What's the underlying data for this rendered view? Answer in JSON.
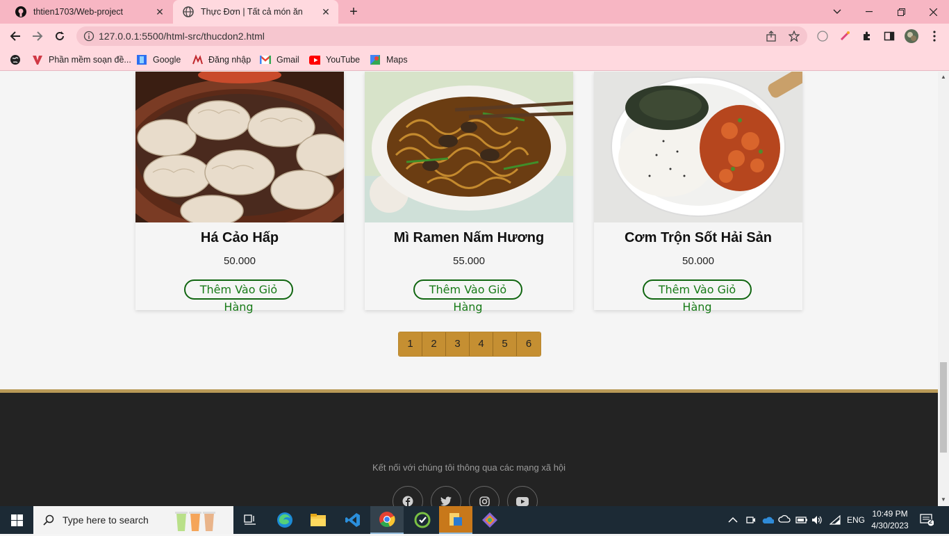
{
  "browser": {
    "tabs": [
      {
        "title": "thtien1703/Web-project",
        "active": false
      },
      {
        "title": "Thực Đơn | Tất cả món ăn",
        "active": true
      }
    ],
    "url": "127.0.0.1:5500/html-src/thucdon2.html",
    "bookmarks": [
      {
        "label": "Phần mềm soạn đề...",
        "icon": "v-logo-icon"
      },
      {
        "label": "Google",
        "icon": "google-icon"
      },
      {
        "label": "Đăng nhập",
        "icon": "login-icon"
      },
      {
        "label": "Gmail",
        "icon": "gmail-icon"
      },
      {
        "label": "YouTube",
        "icon": "youtube-icon"
      },
      {
        "label": "Maps",
        "icon": "maps-icon"
      }
    ]
  },
  "menu": {
    "items": [
      {
        "name": "Há Cảo Hấp",
        "price": "50.000",
        "button": "Thêm Vào Giỏ Hàng"
      },
      {
        "name": "Mì Ramen Nấm Hương",
        "price": "55.000",
        "button": "Thêm Vào Giỏ Hàng"
      },
      {
        "name": "Cơm Trộn Sốt Hải Sản",
        "price": "50.000",
        "button": "Thêm Vào Giỏ Hàng"
      }
    ],
    "pages": [
      "1",
      "2",
      "3",
      "4",
      "5",
      "6"
    ]
  },
  "footer": {
    "tagline": "Kết nối với chúng tôi thông qua các mạng xã hội",
    "social": [
      "facebook-icon",
      "twitter-icon",
      "instagram-icon",
      "youtube-icon"
    ]
  },
  "taskbar": {
    "search_placeholder": "Type here to search",
    "language": "ENG",
    "time": "10:49 PM",
    "date": "4/30/2023",
    "notifications": "2"
  },
  "colors": {
    "tab_bar": "#f7b6c3",
    "toolbar": "#ffd9df",
    "pager": "#c58f32",
    "footer": "#232323",
    "footer_border": "#b99a57",
    "button_green": "#177a17"
  }
}
